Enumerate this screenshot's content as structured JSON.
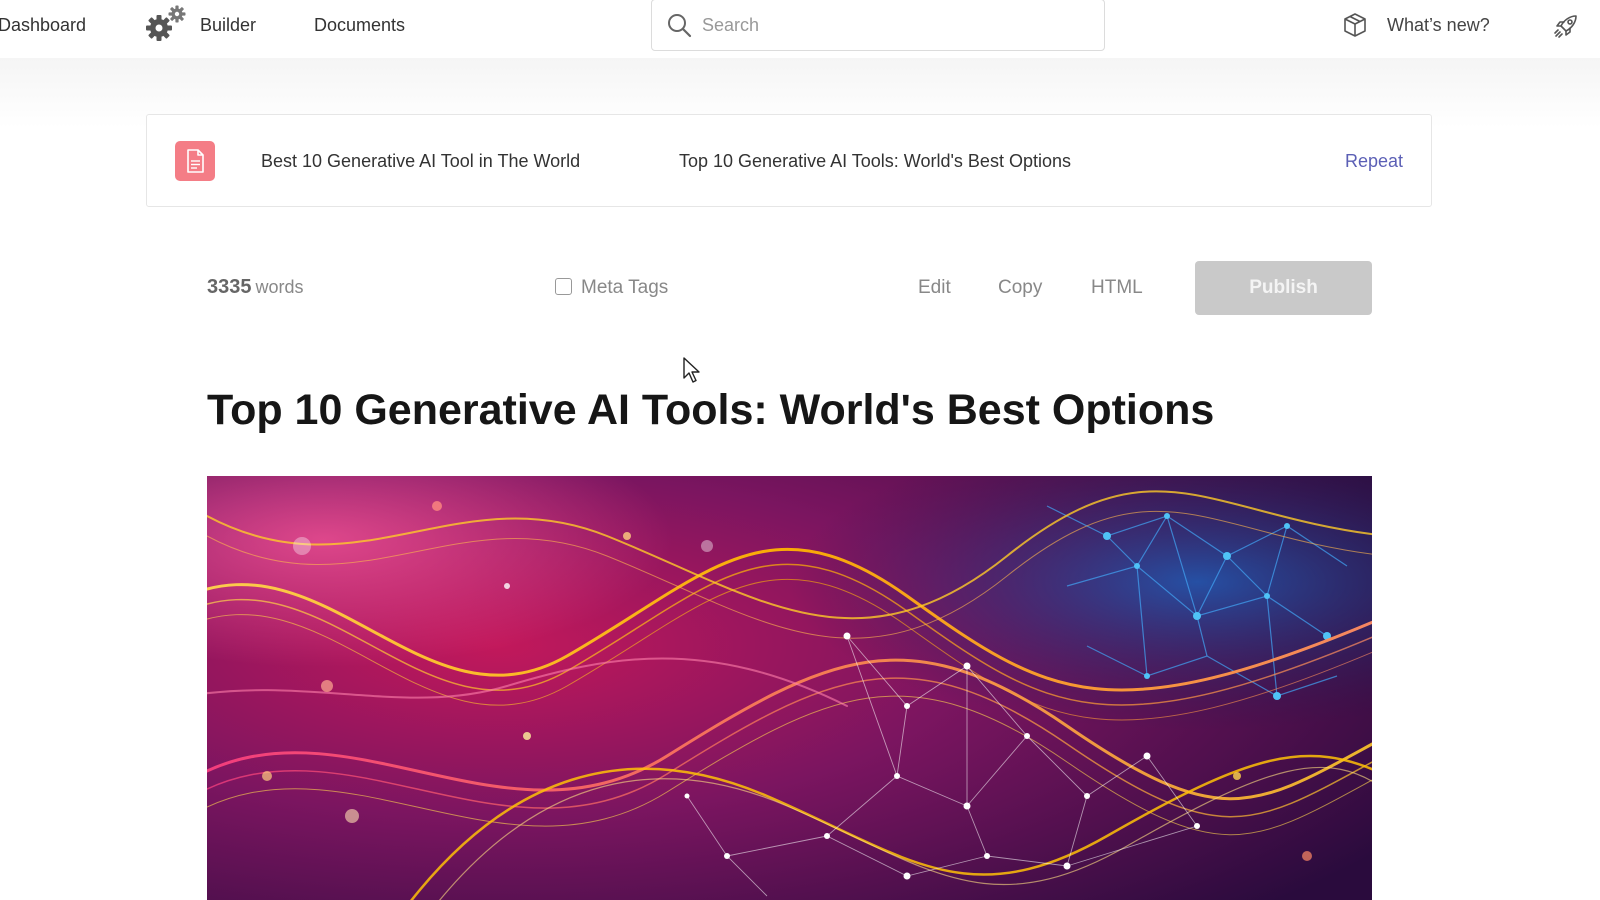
{
  "nav": {
    "dashboard": "Dashboard",
    "builder": "Builder",
    "documents": "Documents",
    "whats_new": "What’s new?"
  },
  "search": {
    "placeholder": "Search"
  },
  "doc_card": {
    "keyword": "Best 10 Generative AI Tool in The World",
    "title": "Top 10 Generative AI Tools: World's Best Options",
    "repeat_label": "Repeat",
    "icon": "document-icon",
    "icon_bg": "#f47d86"
  },
  "toolbar": {
    "word_count": "3335",
    "word_unit": "words",
    "meta_tags_label": "Meta Tags",
    "meta_tags_checked": false,
    "edit_label": "Edit",
    "copy_label": "Copy",
    "html_label": "HTML",
    "publish_label": "Publish"
  },
  "article": {
    "title": "Top 10 Generative AI Tools: World's Best Options",
    "hero_image": "abstract-neural-network-waves"
  },
  "colors": {
    "accent_link": "#5b5fb5",
    "publish_disabled": "#c9c9c9",
    "doc_icon": "#f47d86"
  }
}
